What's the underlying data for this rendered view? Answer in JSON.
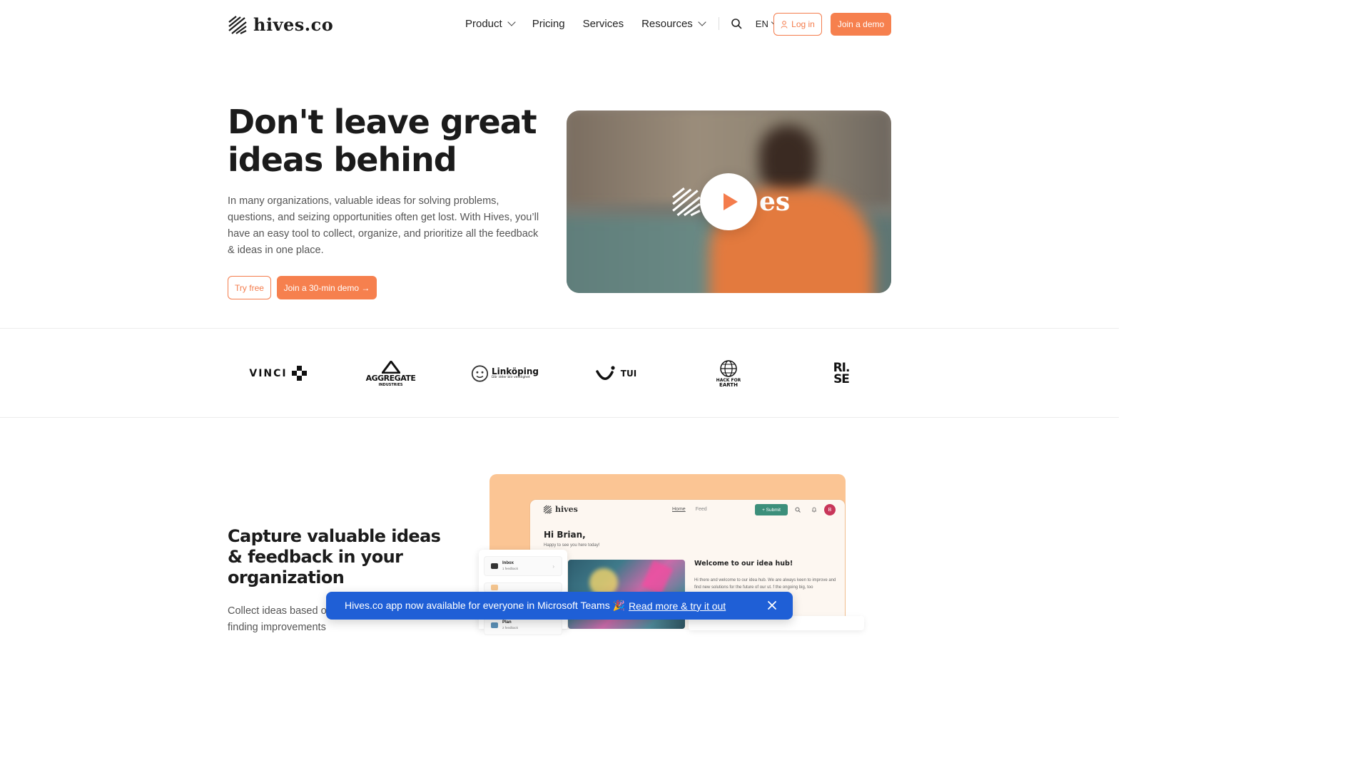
{
  "brand": {
    "name": "hives.co",
    "app_name": "hives"
  },
  "nav": {
    "items": [
      {
        "label": "Product",
        "has_dropdown": true
      },
      {
        "label": "Pricing",
        "has_dropdown": false
      },
      {
        "label": "Services",
        "has_dropdown": false
      },
      {
        "label": "Resources",
        "has_dropdown": true
      }
    ],
    "search_icon": "search-icon",
    "language": "EN",
    "login_label": "Log in",
    "demo_label": "Join a demo"
  },
  "hero": {
    "title": "Don't leave great ideas behind",
    "description": "In many organizations, valuable ideas for solving problems, questions, and seizing opportunities often get lost. With Hives, you’ll have an easy tool to collect, organize, and prioritize all the feedback & ideas in one place.",
    "try_label": "Try free",
    "join_label": "Join a 30-min demo →",
    "video_logo_text": "es"
  },
  "customers": [
    {
      "name": "VINCI",
      "text": "VINCI"
    },
    {
      "name": "Aggregate Industries",
      "text": "AGGREGATE",
      "sub": "INDUSTRIES"
    },
    {
      "name": "Linköping",
      "text": "Linköping",
      "sub": "Där idéer blir verklighet"
    },
    {
      "name": "TUI",
      "text": "TUI"
    },
    {
      "name": "Hack for Earth",
      "text": "HACK FOR",
      "sub": "EARTH"
    },
    {
      "name": "RISE",
      "text": "RI.",
      "sub": "SE"
    }
  ],
  "section2": {
    "title": "Capture valuable ideas & feedback in your organization",
    "description": "Collect ideas based on opportunities and start finding improvements"
  },
  "mockup": {
    "nav_home": "Home",
    "nav_feed": "Feed",
    "submit_label": "+ Submit",
    "avatar_initial": "B",
    "greeting": "Hi Brian,",
    "greeting_sub": "Happy to see you here today!",
    "welcome_title": "Welcome to our idea hub!",
    "welcome_text": "Hi there and welcome to our idea hub. We are always keen to improve and find new solutions for the future of our",
    "welcome_more_1": "ut.",
    "welcome_more_2": "f the ongoing",
    "welcome_more_3": "big, too",
    "sidebar": [
      {
        "title": "Inbox",
        "sub": "1 feedback"
      },
      {
        "title": "Plan",
        "sub": "2 feedback"
      }
    ]
  },
  "banner": {
    "text": "Hives.co app now available for everyone in Microsoft Teams 🎉",
    "link": "Read more & try it out"
  },
  "colors": {
    "accent": "#f6804e",
    "banner": "#1f5fd6",
    "mock_bg": "#fbc594"
  }
}
